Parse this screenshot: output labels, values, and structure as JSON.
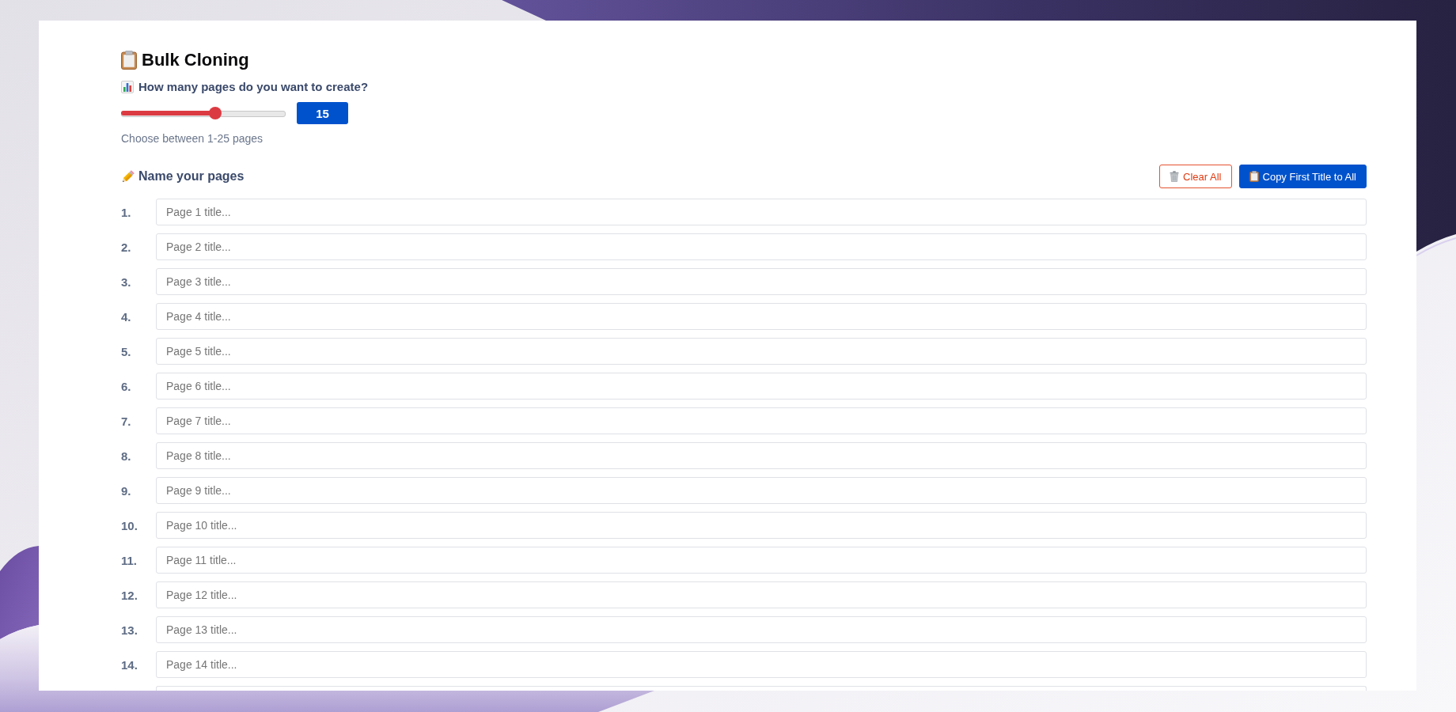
{
  "header": {
    "title": "Bulk Cloning"
  },
  "page_count": {
    "question": "How many pages do you want to create?",
    "level": 0.58,
    "value": "15",
    "hint": "Choose between 1-25 pages"
  },
  "names_section": {
    "heading": "Name your pages",
    "buttons": [
      {
        "kind": "outline",
        "label": "Clear All"
      },
      {
        "kind": "primary",
        "label": "Copy First Title to All"
      }
    ]
  },
  "rows": [
    {
      "kind": "field",
      "number": "1.",
      "placeholder": "Page 1 title..."
    },
    {
      "kind": "field",
      "number": "2.",
      "placeholder": "Page 2 title..."
    },
    {
      "kind": "field",
      "number": "3.",
      "placeholder": "Page 3 title..."
    },
    {
      "kind": "field",
      "number": "4.",
      "placeholder": "Page 4 title..."
    },
    {
      "kind": "field",
      "number": "5.",
      "placeholder": "Page 5 title..."
    },
    {
      "kind": "field",
      "number": "6.",
      "placeholder": "Page 6 title..."
    },
    {
      "kind": "field",
      "number": "7.",
      "placeholder": "Page 7 title..."
    },
    {
      "kind": "field",
      "number": "8.",
      "placeholder": "Page 8 title..."
    },
    {
      "kind": "field",
      "number": "9.",
      "placeholder": "Page 9 title..."
    },
    {
      "kind": "field",
      "number": "10.",
      "placeholder": "Page 10 title..."
    },
    {
      "kind": "field",
      "number": "11.",
      "placeholder": "Page 11 title..."
    },
    {
      "kind": "field",
      "number": "12.",
      "placeholder": "Page 12 title..."
    },
    {
      "kind": "field",
      "number": "13.",
      "placeholder": "Page 13 title..."
    },
    {
      "kind": "field",
      "number": "14.",
      "placeholder": "Page 14 title..."
    },
    {
      "kind": "clipped"
    }
  ]
}
